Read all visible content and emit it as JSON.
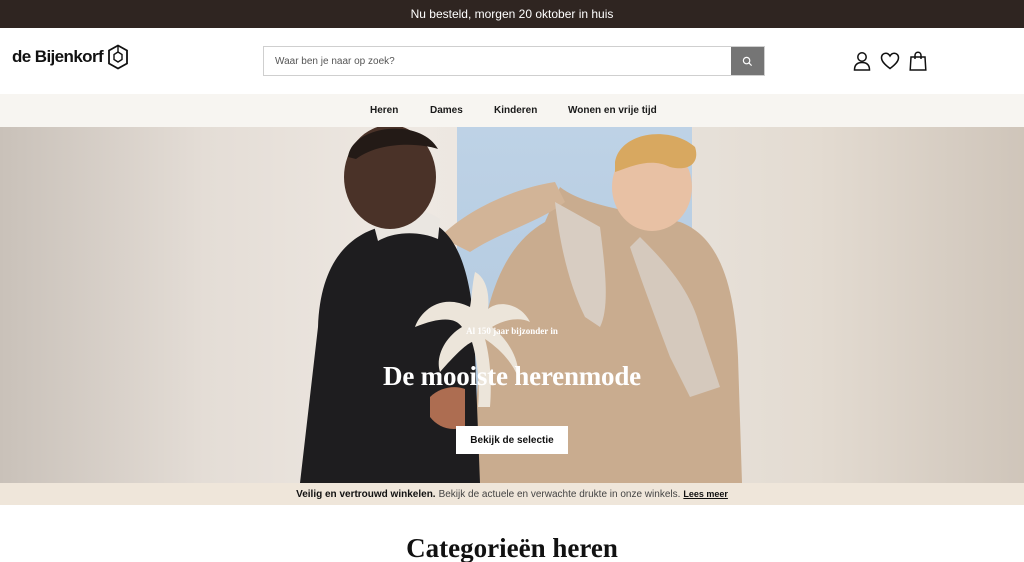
{
  "announcement": "Nu besteld, morgen 20 oktober in huis",
  "brand": {
    "logo_text": "de Bijenkorf"
  },
  "search": {
    "placeholder": "Waar ben je naar op zoek?",
    "button_icon": "search-icon"
  },
  "header_icons": [
    "account-icon",
    "heart-icon",
    "shopping-bag-icon"
  ],
  "nav": {
    "items": [
      "Heren",
      "Dames",
      "Kinderen",
      "Wonen en vrije tijd"
    ]
  },
  "hero": {
    "kicker": "Al 150 jaar bijzonder in",
    "title": "De mooiste herenmode",
    "cta": "Bekijk de selectie"
  },
  "notice": {
    "bold": "Veilig en vertrouwd winkelen.",
    "text": "Bekijk de actuele en verwachte drukte in onze winkels.",
    "link": "Lees meer"
  },
  "section": {
    "title": "Categorieën heren"
  },
  "colors": {
    "topbar": "#2f2521",
    "nav_bg": "#f7f5f1",
    "notice_bg": "#efe6da",
    "search_button": "#757575"
  }
}
